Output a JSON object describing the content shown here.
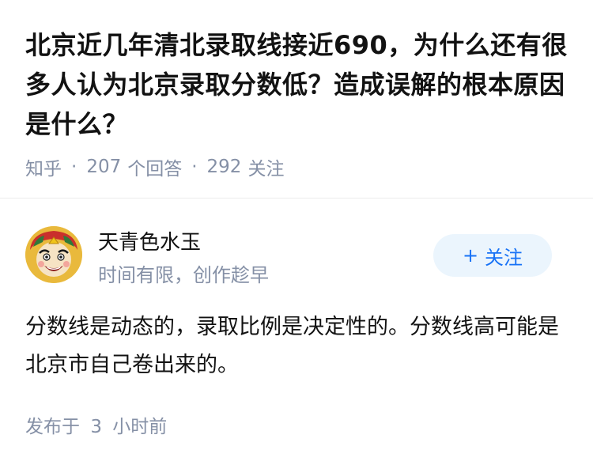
{
  "question": {
    "title": "北京近几年清北录取线接近690，为什么还有很多人认为北京录取分数低？造成误解的根本原因是什么？"
  },
  "meta": {
    "source": "知乎",
    "separator": "·",
    "answers_count": "207",
    "answers_label": "个回答",
    "followers_count": "292",
    "followers_label": "关注"
  },
  "author": {
    "name": "天青色水玉",
    "bio": "时间有限，创作趁早",
    "follow_plus": "+",
    "follow_label": "关注",
    "avatar_icon": "cartoon-face-avatar"
  },
  "answer": {
    "content": "分数线是动态的，录取比例是决定性的。分数线高可能是北京市自己卷出来的。"
  },
  "footer": {
    "publish_prefix": "发布于",
    "publish_number": "3",
    "publish_suffix": "小时前"
  },
  "colors": {
    "accent": "#1772f6",
    "follow_bg": "#ebf5fd",
    "meta_gray": "#8590a6",
    "title": "#121212"
  }
}
